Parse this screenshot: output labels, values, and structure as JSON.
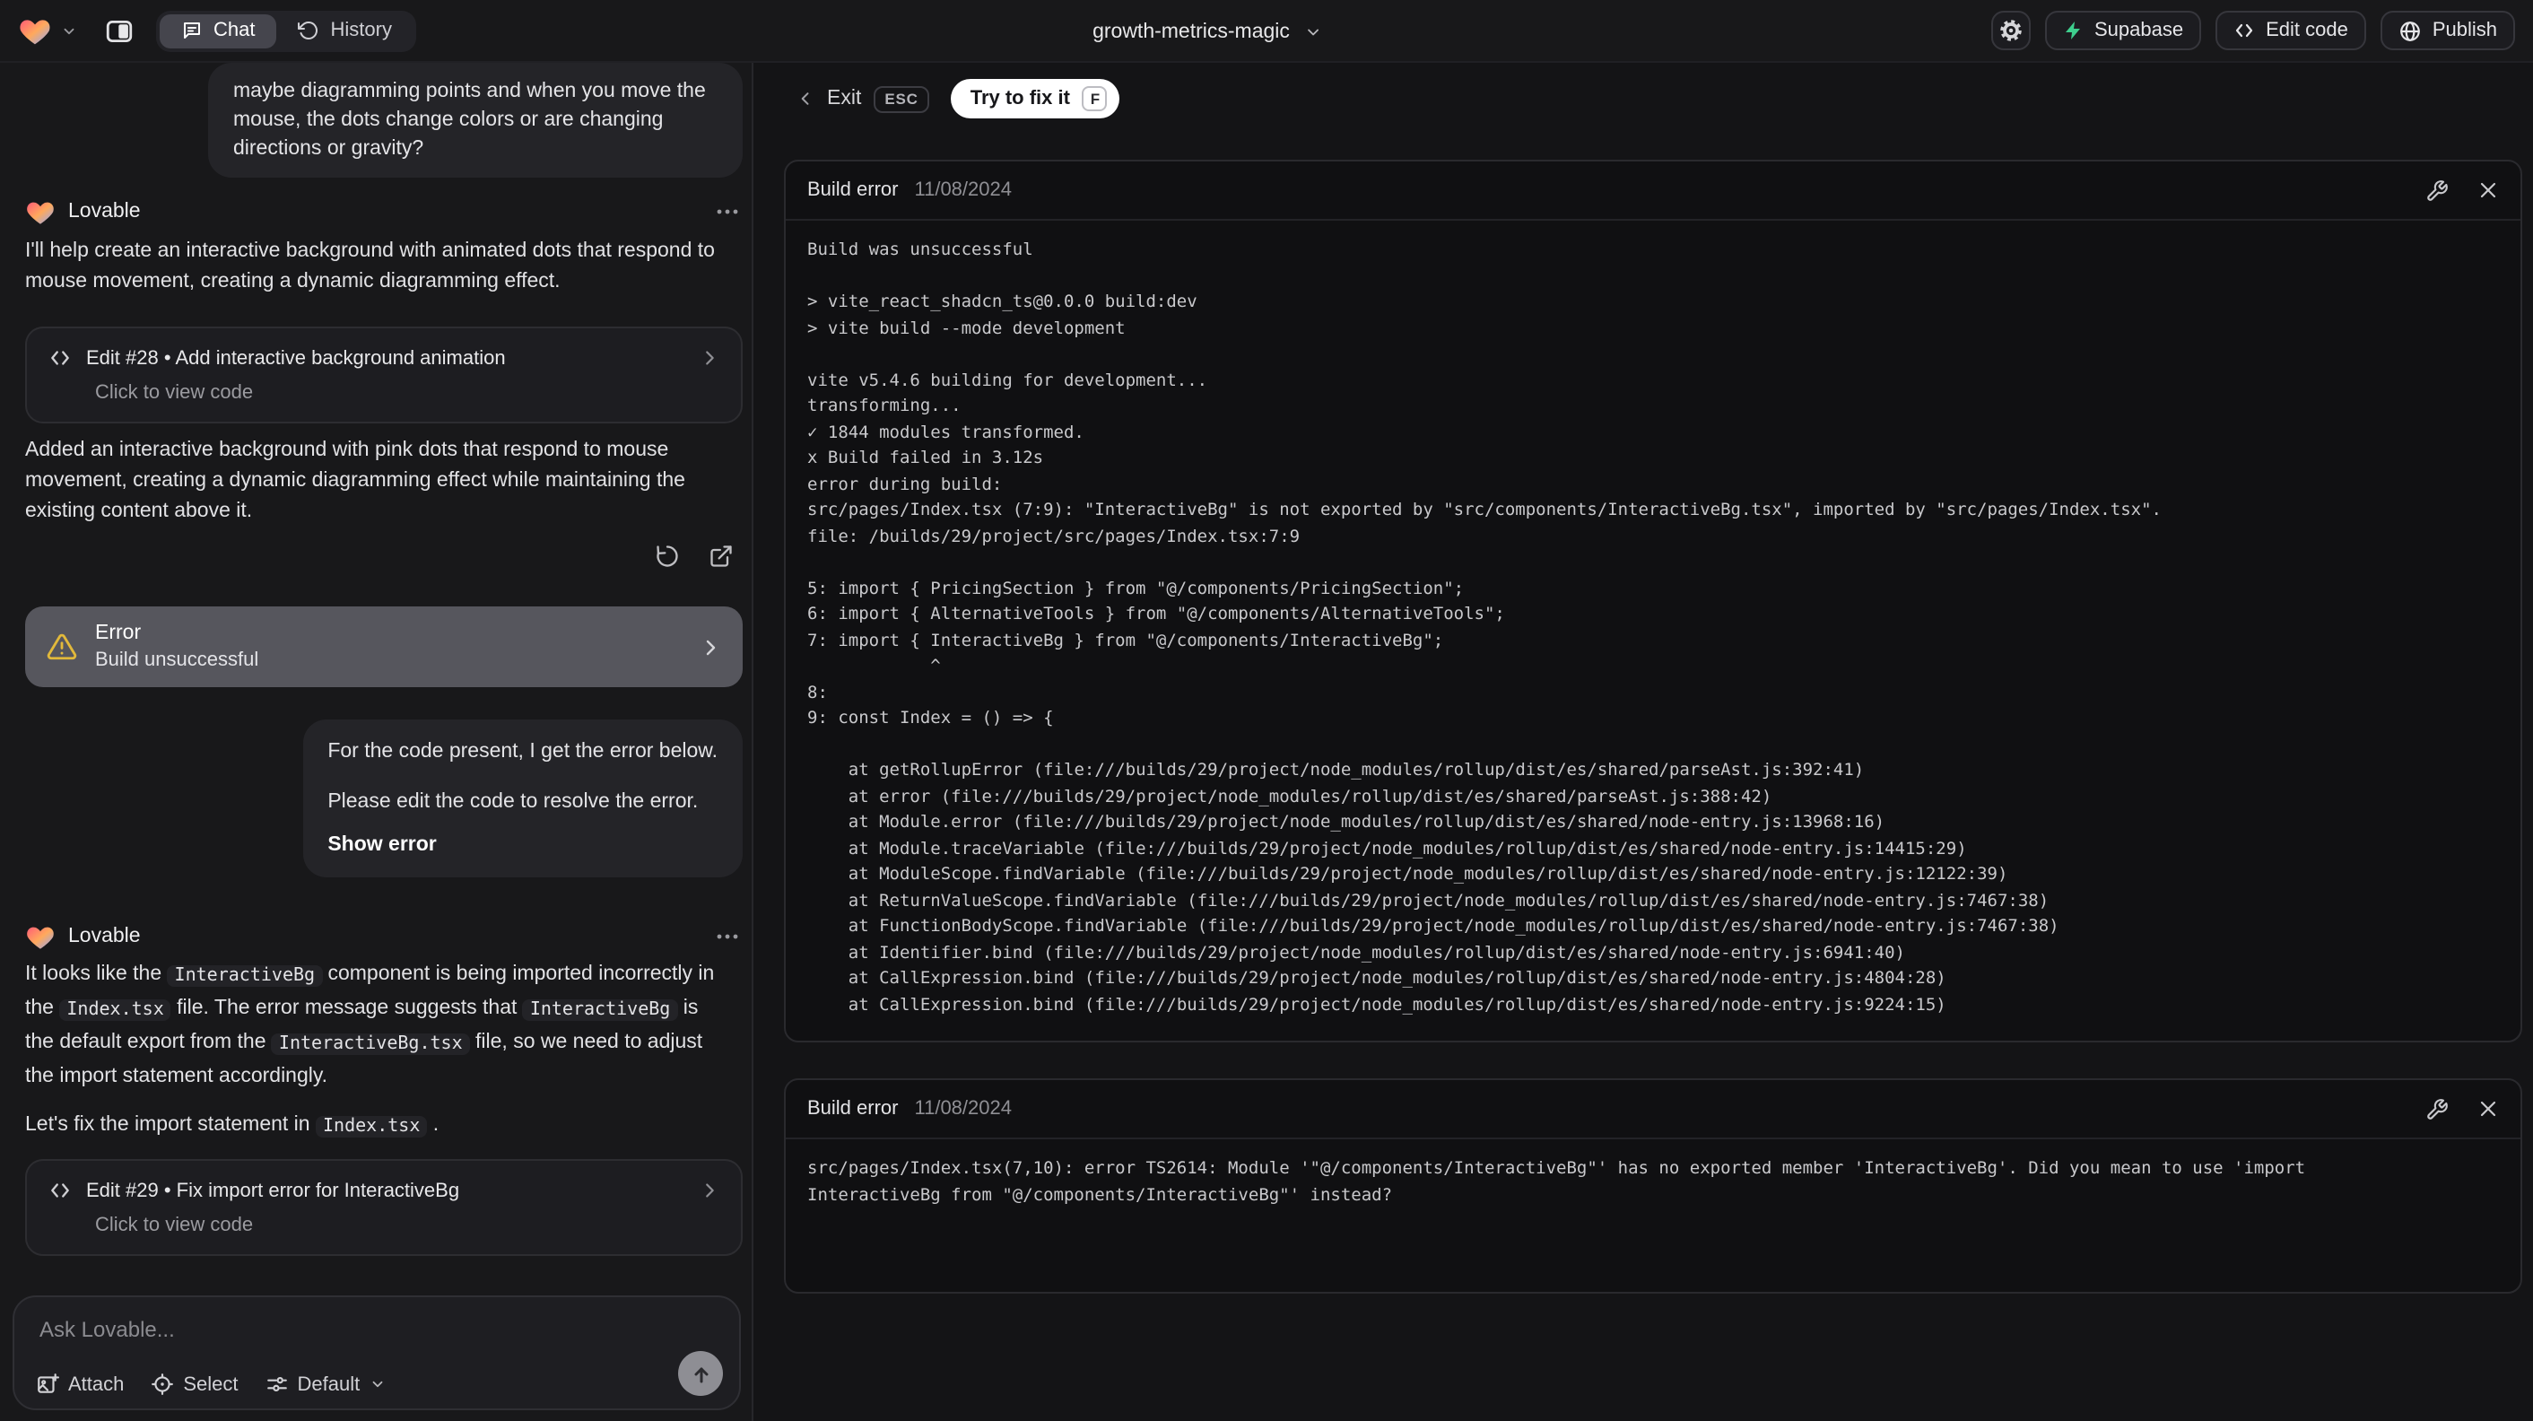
{
  "topbar": {
    "tabs": {
      "chat": "Chat",
      "history": "History"
    },
    "project": {
      "name": "growth-metrics-magic"
    },
    "actions": {
      "supabase": "Supabase",
      "edit_code": "Edit code",
      "publish": "Publish"
    }
  },
  "chat": {
    "user_message_1": "maybe diagramming points and when you move the mouse, the dots change colors or are changing directions or gravity?",
    "assistant_1": {
      "name": "Lovable",
      "intro": "I'll help create an interactive background with animated dots that respond to mouse movement, creating a dynamic diagramming effect.",
      "edit_card": {
        "title": "Edit #28 • Add interactive background animation",
        "subtitle": "Click to view code"
      },
      "summary": "Added an interactive background with pink dots that respond to mouse movement, creating a dynamic diagramming effect while maintaining the existing content above it.",
      "error_card": {
        "title": "Error",
        "subtitle": "Build unsuccessful"
      }
    },
    "user_message_2": {
      "intro": "For the code present, I get the error below.",
      "body": "Please edit the code to resolve the error.",
      "action": "Show error"
    },
    "assistant_2": {
      "name": "Lovable",
      "paragraph_1": [
        {
          "text": "It looks like the "
        },
        {
          "text": "InteractiveBg",
          "code": true
        },
        {
          "text": " component is being imported incorrectly in the "
        },
        {
          "text": "Index.tsx",
          "code": true
        },
        {
          "text": " file. The error message suggests that "
        },
        {
          "text": "InteractiveBg",
          "code": true
        },
        {
          "text": " is the default export from the "
        },
        {
          "text": "InteractiveBg.tsx",
          "code": true
        },
        {
          "text": " file, so we need to adjust the import statement accordingly."
        }
      ],
      "paragraph_2": [
        {
          "text": "Let's fix the import statement in "
        },
        {
          "text": "Index.tsx",
          "code": true
        },
        {
          "text": " ."
        }
      ],
      "edit_card": {
        "title": "Edit #29 • Fix import error for InteractiveBg",
        "subtitle": "Click to view code"
      }
    },
    "composer": {
      "placeholder": "Ask Lovable...",
      "attach": "Attach",
      "select": "Select",
      "mode": "Default"
    }
  },
  "main": {
    "exit_label": "Exit",
    "exit_key": "ESC",
    "fix_label": "Try to fix it",
    "fix_key": "F",
    "error_cards": [
      {
        "title": "Build error",
        "date": "11/08/2024",
        "log": [
          "Build was unsuccessful",
          "",
          "> vite_react_shadcn_ts@0.0.0 build:dev",
          "> vite build --mode development",
          "",
          "vite v5.4.6 building for development...",
          "transforming...",
          "✓ 1844 modules transformed.",
          "x Build failed in 3.12s",
          "error during build:",
          "src/pages/Index.tsx (7:9): \"InteractiveBg\" is not exported by \"src/components/InteractiveBg.tsx\", imported by \"src/pages/Index.tsx\".",
          "file: /builds/29/project/src/pages/Index.tsx:7:9",
          "",
          "5: import { PricingSection } from \"@/components/PricingSection\";",
          "6: import { AlternativeTools } from \"@/components/AlternativeTools\";",
          "7: import { InteractiveBg } from \"@/components/InteractiveBg\";",
          "            ^",
          "8: ",
          "9: const Index = () => {",
          "",
          "    at getRollupError (file:///builds/29/project/node_modules/rollup/dist/es/shared/parseAst.js:392:41)",
          "    at error (file:///builds/29/project/node_modules/rollup/dist/es/shared/parseAst.js:388:42)",
          "    at Module.error (file:///builds/29/project/node_modules/rollup/dist/es/shared/node-entry.js:13968:16)",
          "    at Module.traceVariable (file:///builds/29/project/node_modules/rollup/dist/es/shared/node-entry.js:14415:29)",
          "    at ModuleScope.findVariable (file:///builds/29/project/node_modules/rollup/dist/es/shared/node-entry.js:12122:39)",
          "    at ReturnValueScope.findVariable (file:///builds/29/project/node_modules/rollup/dist/es/shared/node-entry.js:7467:38)",
          "    at FunctionBodyScope.findVariable (file:///builds/29/project/node_modules/rollup/dist/es/shared/node-entry.js:7467:38)",
          "    at Identifier.bind (file:///builds/29/project/node_modules/rollup/dist/es/shared/node-entry.js:6941:40)",
          "    at CallExpression.bind (file:///builds/29/project/node_modules/rollup/dist/es/shared/node-entry.js:4804:28)",
          "    at CallExpression.bind (file:///builds/29/project/node_modules/rollup/dist/es/shared/node-entry.js:9224:15)"
        ]
      },
      {
        "title": "Build error",
        "date": "11/08/2024",
        "log": [
          "src/pages/Index.tsx(7,10): error TS2614: Module '\"@/components/InteractiveBg\"' has no exported member 'InteractiveBg'. Did you mean to use 'import",
          "InteractiveBg from \"@/components/InteractiveBg\"' instead?"
        ]
      }
    ]
  },
  "colors": {
    "supabase_green": "#3ecf8e",
    "warning_amber": "#e2b93b",
    "selected_card": "#56565d"
  }
}
